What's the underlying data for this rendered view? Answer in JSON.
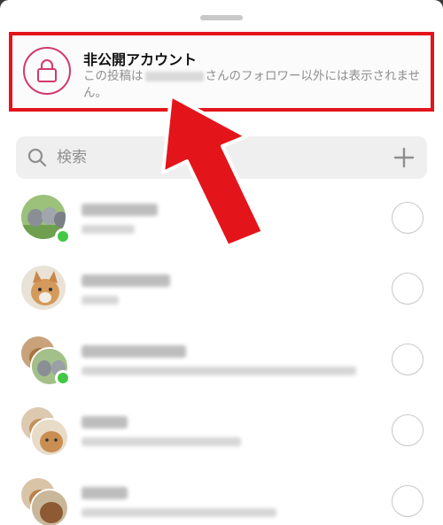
{
  "banner": {
    "title": "非公開アカウント",
    "desc_before": "この投稿は",
    "desc_after": "さんのフォロワー以外には表示されません。"
  },
  "search": {
    "placeholder": "検索"
  },
  "colors": {
    "highlight": "#e4141b",
    "lock": "#d23a6a",
    "online": "#44c745"
  },
  "icons": [
    "lock-icon",
    "search-icon",
    "plus-icon",
    "radio-circle"
  ]
}
